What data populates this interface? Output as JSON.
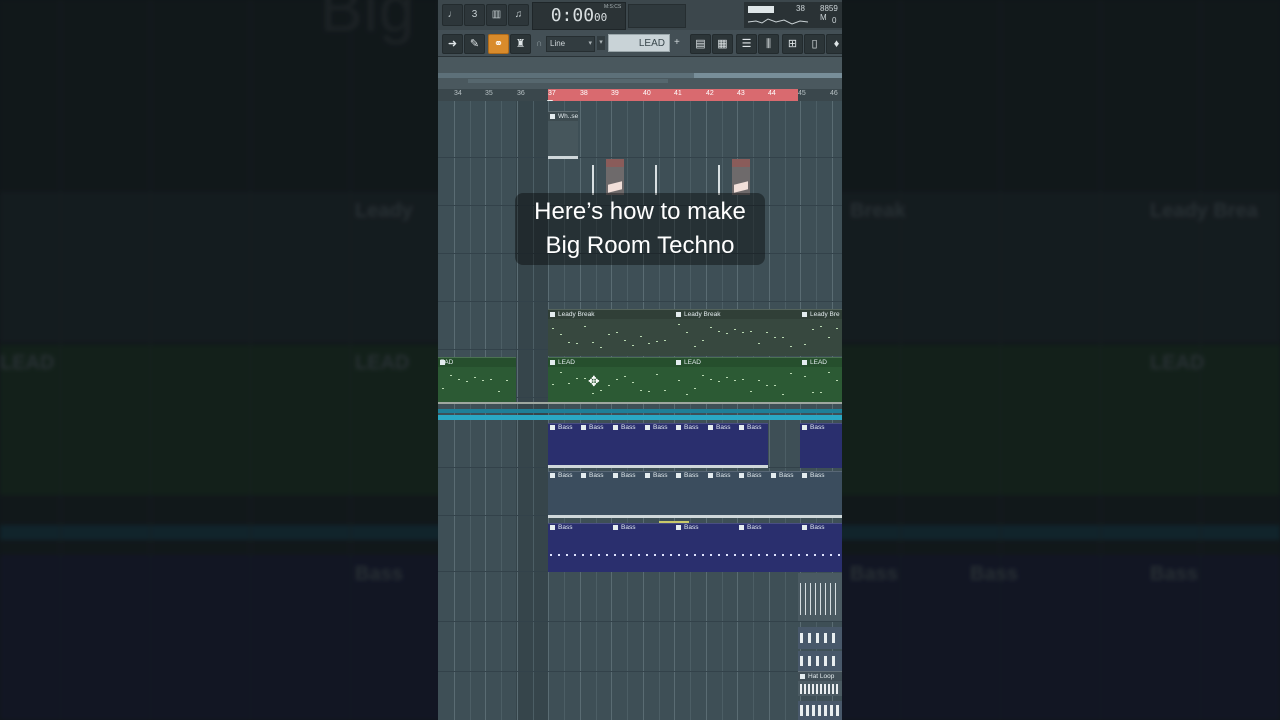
{
  "caption": {
    "line1": "Here’s how to make",
    "line2": "Big Room Techno"
  },
  "background": {
    "title_fragment": "Big Ro          hno",
    "labels": [
      "Leady",
      "Break",
      "Leady Brea",
      "LEAD",
      "LEAD",
      "LEAD",
      "Bass",
      "Bass",
      "Bass",
      "Bass"
    ]
  },
  "toolbar": {
    "time": "0:00",
    "time_sub": "00",
    "time_unit": "M:S:CS",
    "cpu_value": "38",
    "memory_value": "8859 M",
    "polyphony": "0",
    "snap_mode": "Line",
    "pattern_name": "LEAD",
    "plus": "+"
  },
  "ruler": {
    "ticks": [
      "34",
      "35",
      "36",
      "37",
      "38",
      "39",
      "40",
      "41",
      "42",
      "43",
      "44",
      "45",
      "46"
    ]
  },
  "clips": {
    "whitenoise": "Wh..se",
    "leady_break": [
      "Leady Break",
      "Leady Break",
      "Leady Bre"
    ],
    "lead": [
      "EAD",
      "LEAD",
      "LEAD",
      "LEAD"
    ],
    "bass_row1": [
      "Bass",
      "Bass",
      "Bass",
      "Bass",
      "Bass",
      "Bass",
      "Bass",
      "Bass",
      "Bass"
    ],
    "bass_row2": [
      "Bass",
      "Bass",
      "Bass",
      "Bass",
      "Bass",
      "Bass",
      "Bass",
      "Bass",
      "Bass",
      "Bass"
    ],
    "bass_row3": [
      "Bass",
      "Bass",
      "Bass",
      "Bass",
      "Bass"
    ],
    "hat_loop": "Hat Loop"
  },
  "colors": {
    "green_clip": "#2c5a34",
    "purple_clip": "#2a2f6e",
    "loop_region": "#d96a6f",
    "accent_button": "#d98b2b",
    "cyan_line": "#2aa8c4"
  }
}
